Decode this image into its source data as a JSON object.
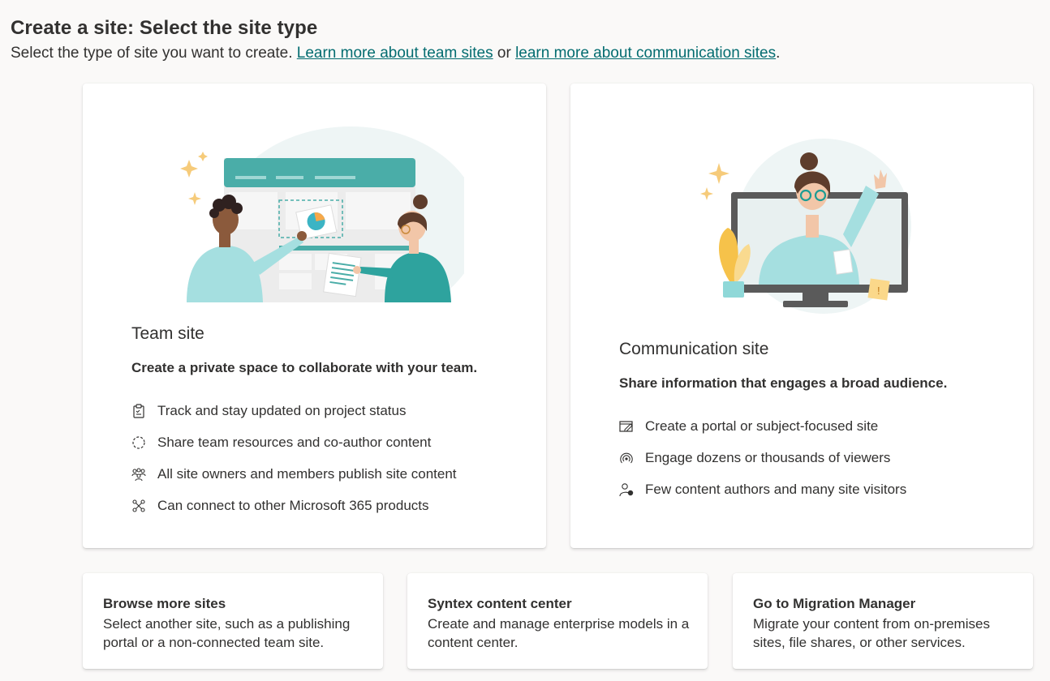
{
  "header": {
    "title": "Create a site: Select the site type",
    "subtitle_prefix": "Select the type of site you want to create. ",
    "link_team": "Learn more about team sites",
    "subtitle_or": " or ",
    "link_comm": "learn more about communication sites",
    "subtitle_suffix": "."
  },
  "team_site": {
    "title": "Team site",
    "description": "Create a private space to collaborate with your team.",
    "features": [
      {
        "icon": "clipboard-checklist-icon",
        "label": "Track and stay updated on project status"
      },
      {
        "icon": "sync-circle-icon",
        "label": "Share team resources and co-author content"
      },
      {
        "icon": "people-team-icon",
        "label": "All site owners and members publish site content"
      },
      {
        "icon": "connector-icon",
        "label": "Can connect to other Microsoft 365 products"
      }
    ]
  },
  "communication_site": {
    "title": "Communication site",
    "description": "Share information that engages a broad audience.",
    "features": [
      {
        "icon": "edit-page-icon",
        "label": "Create a portal or subject-focused site"
      },
      {
        "icon": "broadcast-icon",
        "label": "Engage dozens or thousands of viewers"
      },
      {
        "icon": "person-author-icon",
        "label": "Few content authors and many site visitors"
      }
    ]
  },
  "bottom_cards": [
    {
      "title": "Browse more sites",
      "description": "Select another site, such as a publishing portal or a non-connected team site."
    },
    {
      "title": "Syntex content center",
      "description": "Create and manage enterprise models in a content center."
    },
    {
      "title": "Go to Migration Manager",
      "description": "Migrate your content from on-premises sites, file shares, or other services."
    }
  ],
  "colors": {
    "link": "#036c70",
    "accent_teal": "#4aada8",
    "illustration_bg": "#e8f4f4"
  }
}
